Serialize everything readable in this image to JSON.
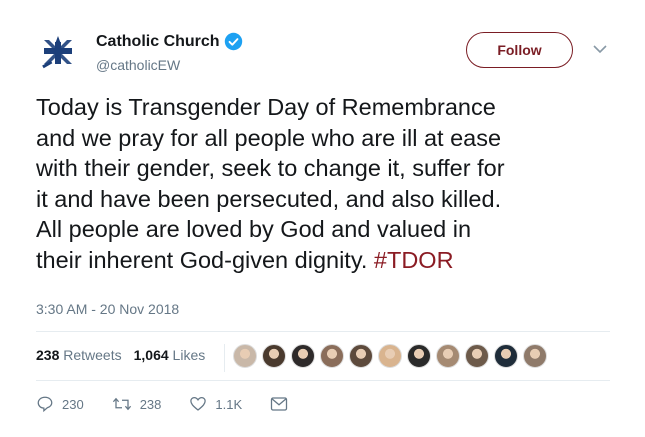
{
  "account": {
    "name": "Catholic Church",
    "handle": "@catholicEW",
    "follow_label": "Follow"
  },
  "tweet": {
    "lines": [
      "Today is Transgender Day of Remembrance",
      "and we pray for all people who are ill at ease",
      "with their gender, seek to change it, suffer for",
      "it and have been persecuted, and also killed.",
      "All people are loved by God and valued in"
    ],
    "last_line_text": "their inherent God-given dignity. ",
    "hashtag": "#TDOR",
    "timestamp": "3:30 AM - 20 Nov 2018"
  },
  "stats": {
    "retweets_count": "238",
    "retweets_label": "Retweets",
    "likes_count": "1,064",
    "likes_label": "Likes",
    "face_colors": [
      "#c9b8a8",
      "#4a3a2e",
      "#2e2a2a",
      "#8a6d5a",
      "#5d4a3c",
      "#d9b48f",
      "#2a2a2a",
      "#a58a72",
      "#6d5a4a",
      "#1f2d3a",
      "#8f7a6a"
    ]
  },
  "actions": {
    "replies": "230",
    "retweets": "238",
    "likes": "1.1K"
  },
  "colors": {
    "accent": "#8b1c24",
    "verified": "#1da1f2",
    "muted": "#657786"
  }
}
